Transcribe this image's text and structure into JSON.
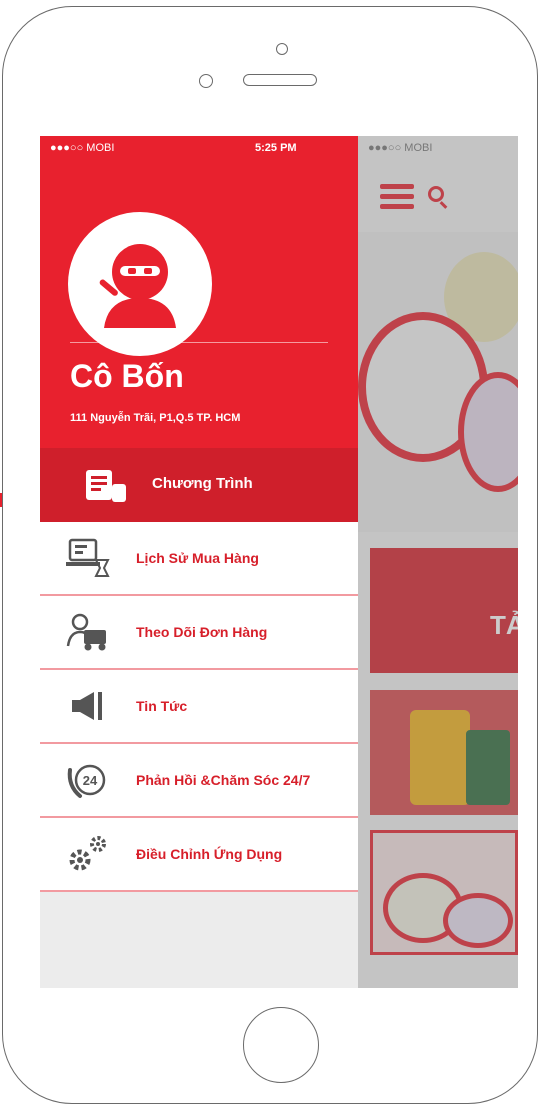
{
  "status_bar": {
    "carrier": "●●●○○ MOBI",
    "time": "5:25 PM"
  },
  "app_status": {
    "carrier": "●●●○○ MOBI"
  },
  "profile": {
    "name": "Cô Bốn",
    "address": "111 Nguyễn Trãi, P1,Q.5 TP. HCM"
  },
  "nav_active": {
    "label": "Chương Trình",
    "icon": "promotion-ticket-icon"
  },
  "menu": [
    {
      "label": "Lịch Sử Mua Hàng",
      "icon": "purchase-history-icon"
    },
    {
      "label": "Theo Dõi Đơn Hàng",
      "icon": "delivery-truck-icon"
    },
    {
      "label": "Tin Tức",
      "icon": "megaphone-icon"
    },
    {
      "label": "Phản Hồi &Chăm Sóc 24/7",
      "icon": "support-24-icon"
    },
    {
      "label": "Điều Chỉnh Ứng Dụng",
      "icon": "settings-gears-icon"
    }
  ],
  "banner_text": "TẢ",
  "colors": {
    "brand_red": "#e8212e",
    "active_red": "#cf1f2b",
    "divider_pink": "#f29aa0",
    "menu_text": "#d71f2a"
  }
}
